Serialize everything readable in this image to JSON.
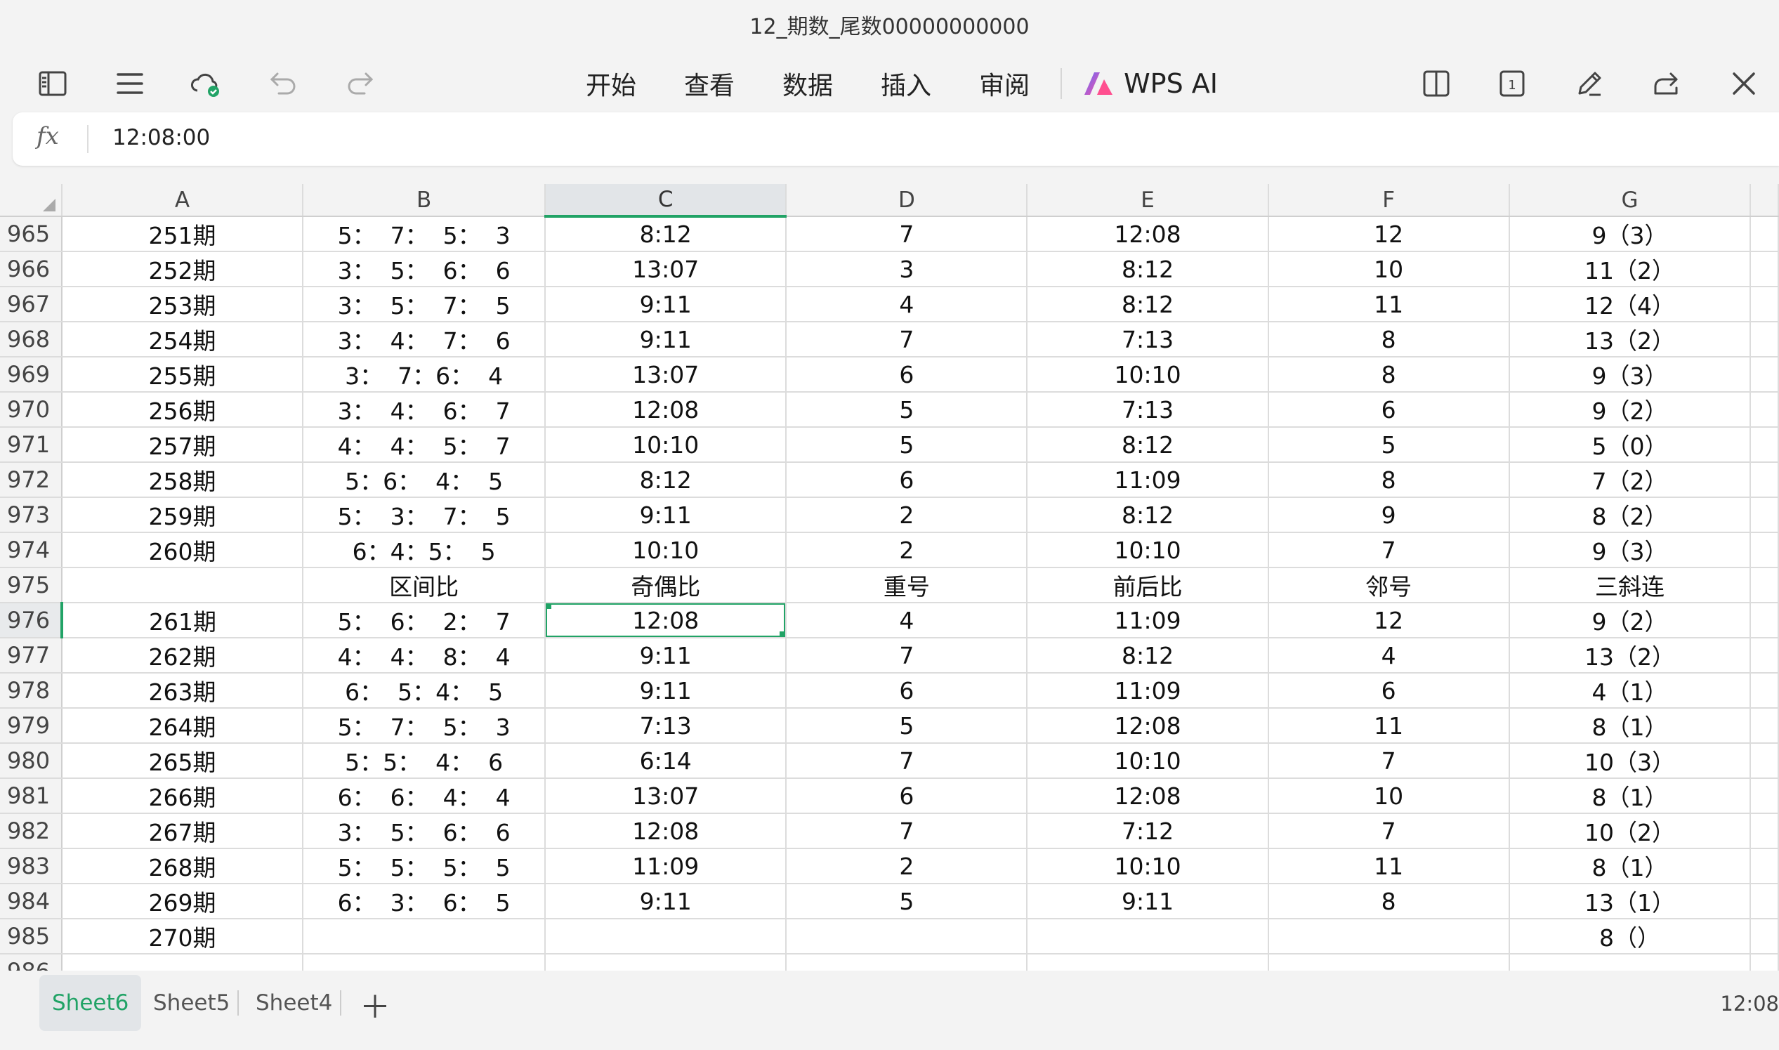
{
  "window": {
    "title": "12_期数_尾数00000000000"
  },
  "menu": {
    "items": [
      "开始",
      "查看",
      "数据",
      "插入",
      "审阅"
    ],
    "ai_label": "WPS AI"
  },
  "toolbar": {
    "left_icons": [
      "sidebar-icon",
      "menu-icon",
      "cloud-sync-icon",
      "undo-icon",
      "redo-icon"
    ],
    "right_icons": [
      "split-view-icon",
      "page-count-icon",
      "pen-icon",
      "share-icon",
      "close-icon"
    ],
    "page_count": "1"
  },
  "formula_bar": {
    "fx_label": "fx",
    "value": "12:08:00"
  },
  "columns": [
    "A",
    "B",
    "C",
    "D",
    "E",
    "F",
    "G"
  ],
  "active_column": "C",
  "active_row": "976",
  "selected_cell": {
    "row": "976",
    "col": "C"
  },
  "rows": [
    {
      "num": "965",
      "cells": [
        "251期",
        "5：  7：  5：  3",
        "8:12",
        "7",
        "12:08",
        "12",
        "9（3）"
      ]
    },
    {
      "num": "966",
      "cells": [
        "252期",
        "3：  5：  6：  6",
        "13:07",
        "3",
        "8:12",
        "10",
        "11（2）"
      ]
    },
    {
      "num": "967",
      "cells": [
        "253期",
        "3：  5：  7：  5",
        "9:11",
        "4",
        "8:12",
        "11",
        "12（4）"
      ]
    },
    {
      "num": "968",
      "cells": [
        "254期",
        "3：  4：  7：  6",
        "9:11",
        "7",
        "7:13",
        "8",
        "13（2）"
      ]
    },
    {
      "num": "969",
      "cells": [
        "255期",
        "3：  7：6：  4",
        "13:07",
        "6",
        "10:10",
        "8",
        "9（3）"
      ]
    },
    {
      "num": "970",
      "cells": [
        "256期",
        "3：  4：  6：  7",
        "12:08",
        "5",
        "7:13",
        "6",
        "9（2）"
      ]
    },
    {
      "num": "971",
      "cells": [
        "257期",
        "4：  4：  5：  7",
        "10:10",
        "5",
        "8:12",
        "5",
        "5（0）"
      ]
    },
    {
      "num": "972",
      "cells": [
        "258期",
        "5：6：  4：  5",
        "8:12",
        "6",
        "11:09",
        "8",
        "7（2）"
      ]
    },
    {
      "num": "973",
      "cells": [
        "259期",
        "5：  3：  7：  5",
        "9:11",
        "2",
        "8:12",
        "9",
        "8（2）"
      ]
    },
    {
      "num": "974",
      "cells": [
        "260期",
        "6：4：5：  5",
        "10:10",
        "2",
        "10:10",
        "7",
        "9（3）"
      ]
    },
    {
      "num": "975",
      "cells": [
        "",
        "区间比",
        "奇偶比",
        "重号",
        "前后比",
        "邻号",
        "三斜连"
      ]
    },
    {
      "num": "976",
      "cells": [
        "261期",
        "5：  6：  2：  7",
        "12:08",
        "4",
        "11:09",
        "12",
        "9（2）"
      ]
    },
    {
      "num": "977",
      "cells": [
        "262期",
        "4：  4：  8：  4",
        "9:11",
        "7",
        "8:12",
        "4",
        "13（2）"
      ]
    },
    {
      "num": "978",
      "cells": [
        "263期",
        "6：  5：4：  5",
        "9:11",
        "6",
        "11:09",
        "6",
        "4（1）"
      ]
    },
    {
      "num": "979",
      "cells": [
        "264期",
        "5：  7：  5：  3",
        "7:13",
        "5",
        "12:08",
        "11",
        "8（1）"
      ]
    },
    {
      "num": "980",
      "cells": [
        "265期",
        "5：5：  4：  6",
        "6:14",
        "7",
        "10:10",
        "7",
        "10（3）"
      ]
    },
    {
      "num": "981",
      "cells": [
        "266期",
        "6：  6：  4：  4",
        "13:07",
        "6",
        "12:08",
        "10",
        "8（1）"
      ]
    },
    {
      "num": "982",
      "cells": [
        "267期",
        "3：  5：  6：  6",
        "12:08",
        "7",
        "7:12",
        "7",
        "10（2）"
      ]
    },
    {
      "num": "983",
      "cells": [
        "268期",
        "5：  5：  5：  5",
        "11:09",
        "2",
        "10:10",
        "11",
        "8（1）"
      ]
    },
    {
      "num": "984",
      "cells": [
        "269期",
        "6：  3：  6：  5",
        "9:11",
        "5",
        "9:11",
        "8",
        "13（1）"
      ]
    },
    {
      "num": "985",
      "cells": [
        "270期",
        "",
        "",
        "",
        "",
        "",
        "8（）"
      ]
    },
    {
      "num": "986",
      "cells": [
        "",
        "",
        "",
        "",
        "",
        "",
        ""
      ]
    }
  ],
  "sheets": [
    "Sheet6",
    "Sheet5",
    "Sheet4"
  ],
  "active_sheet": "Sheet6",
  "status": {
    "clock": "12:08"
  },
  "colors": {
    "accent": "#21a366"
  }
}
